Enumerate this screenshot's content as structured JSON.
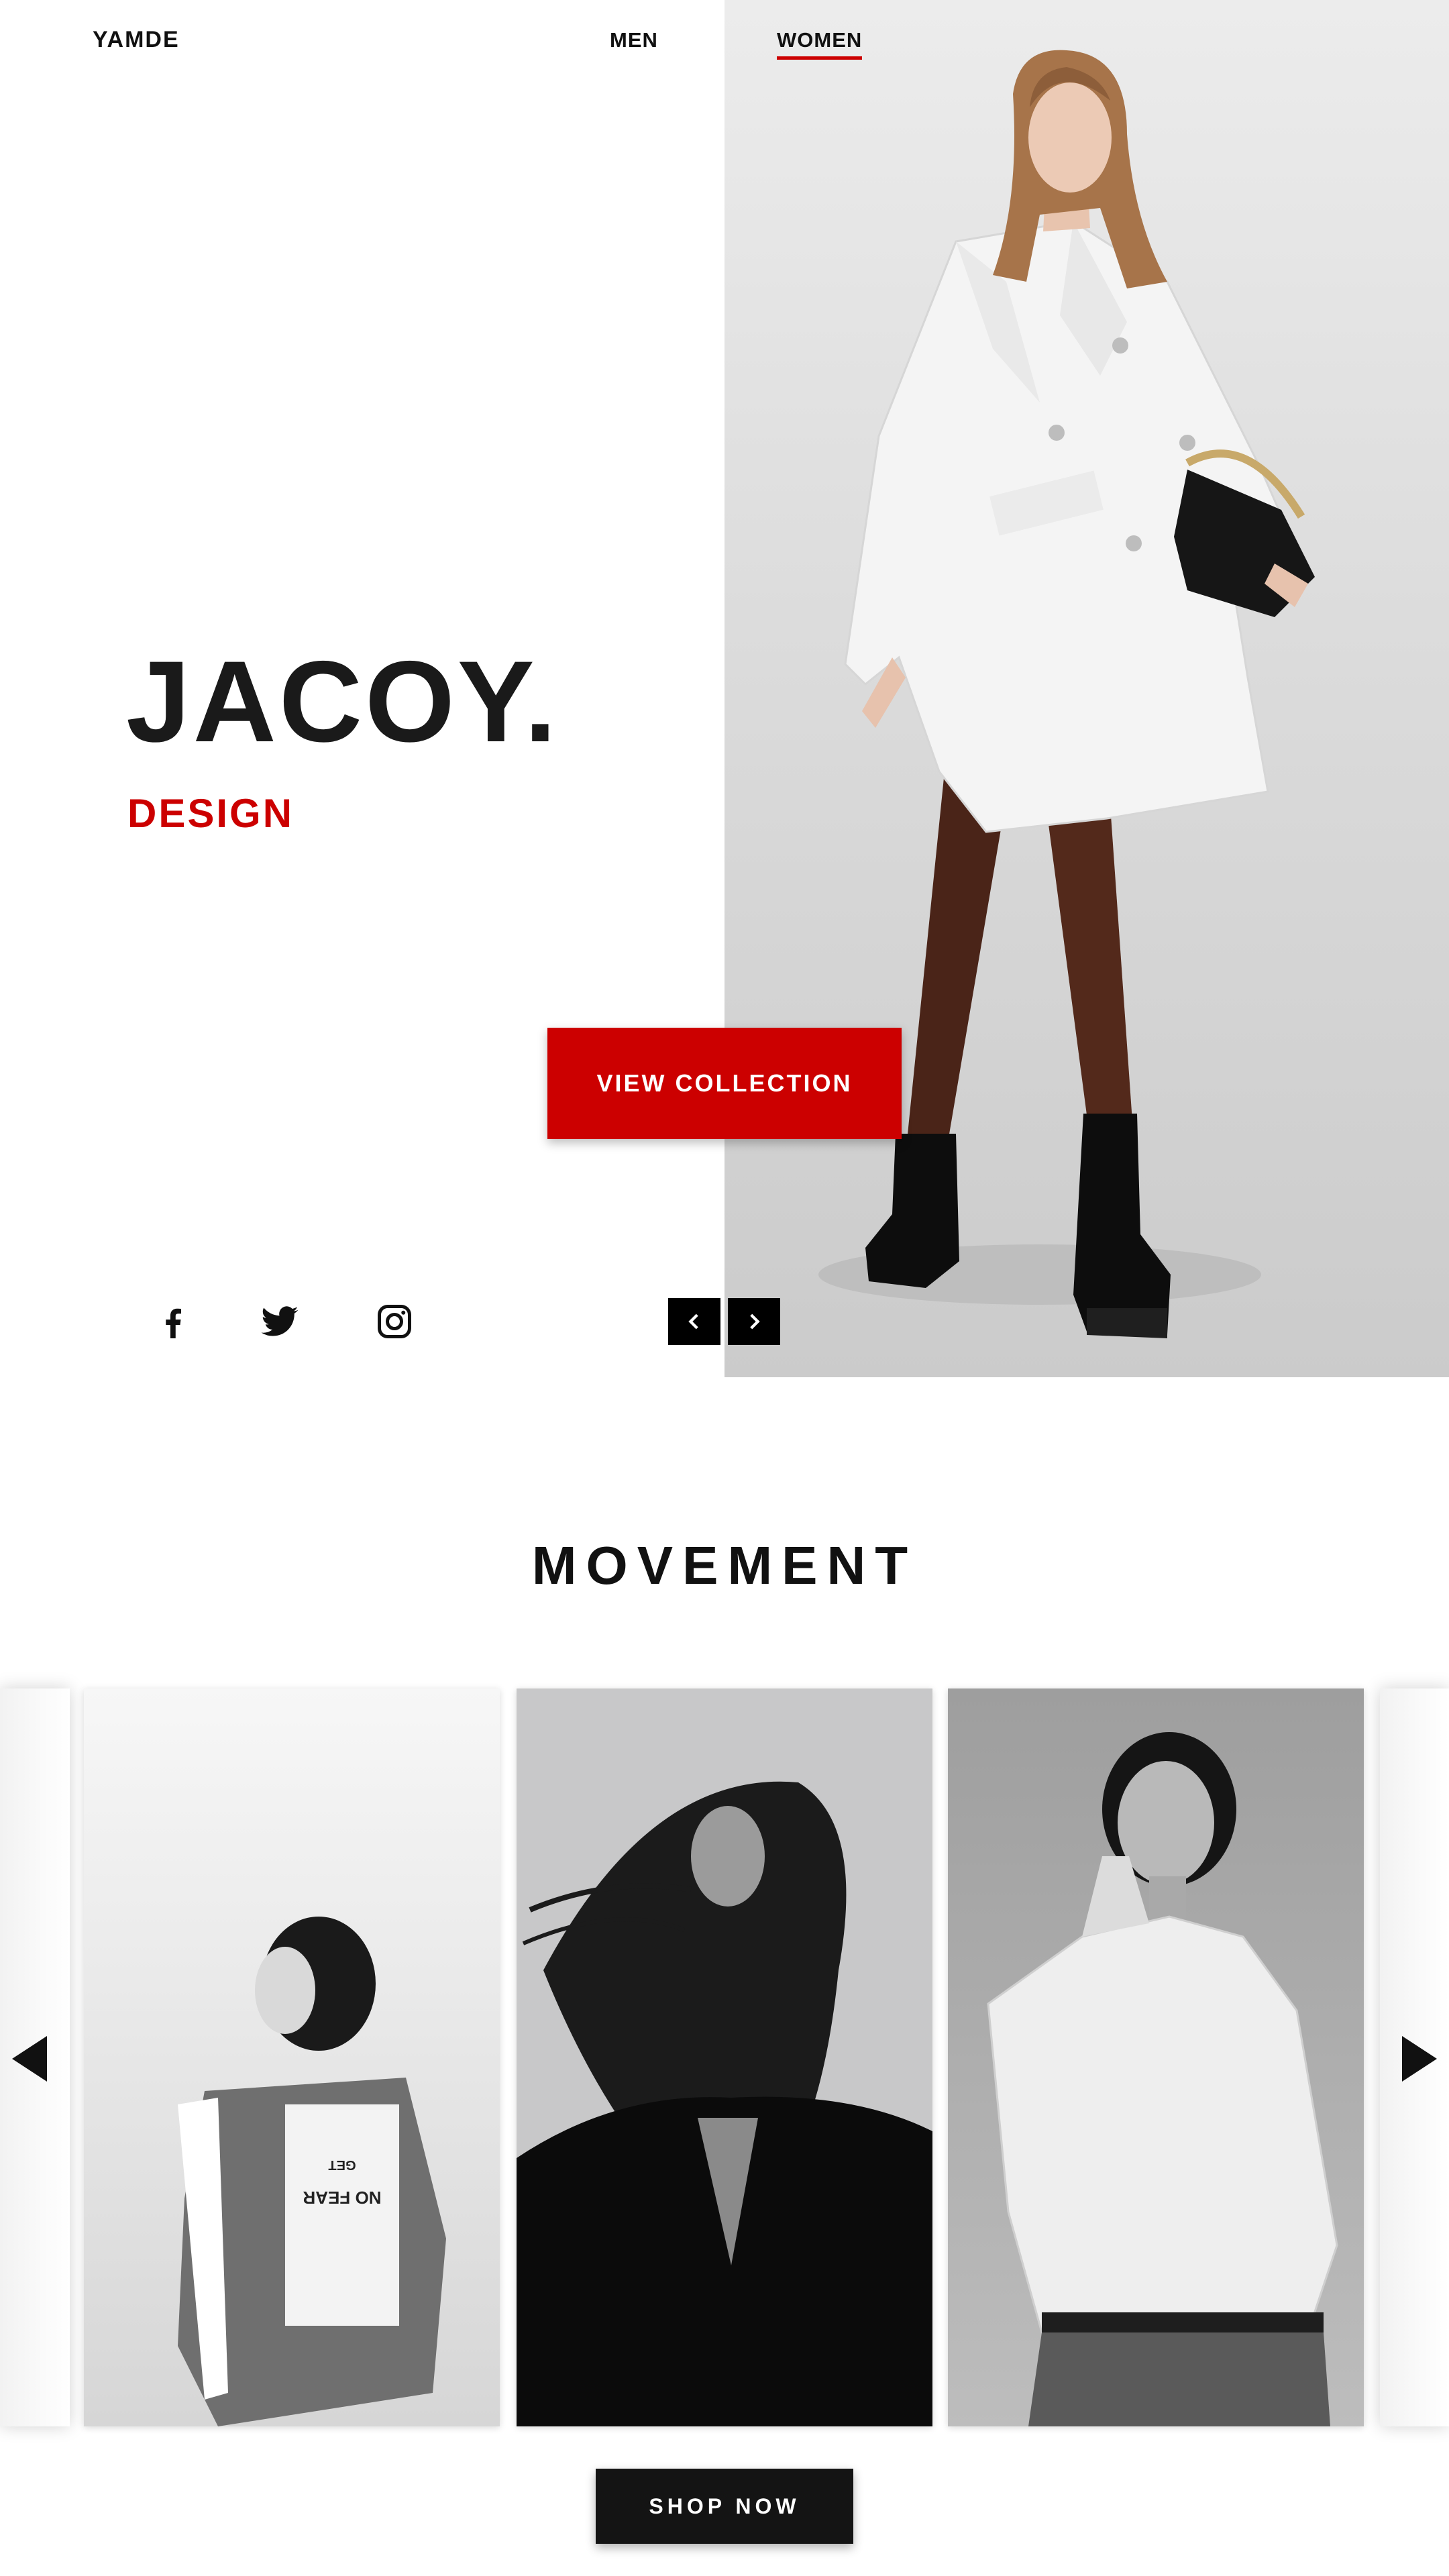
{
  "brand": {
    "logo": "YAMDE"
  },
  "nav": {
    "items": [
      {
        "label": "MEN",
        "active": false
      },
      {
        "label": "WOMEN",
        "active": true
      }
    ]
  },
  "hero": {
    "title": "JACOY.",
    "subtitle": "DESIGN",
    "cta_label": "VIEW COLLECTION",
    "slider_prev_icon": "chevron-left-icon",
    "slider_next_icon": "chevron-right-icon"
  },
  "social": [
    {
      "name": "facebook",
      "icon": "facebook-icon"
    },
    {
      "name": "twitter",
      "icon": "twitter-icon"
    },
    {
      "name": "instagram",
      "icon": "instagram-icon"
    }
  ],
  "movement": {
    "title": "MOVEMENT",
    "cards": [
      {
        "jacket_print_lines": [
          "NO FEAR",
          "GET"
        ]
      },
      {},
      {}
    ],
    "prev_icon": "triangle-left-icon",
    "next_icon": "triangle-right-icon",
    "cta_label": "SHOP NOW"
  },
  "colors": {
    "accent": "#cc0000",
    "dark": "#111111",
    "background": "#ffffff"
  }
}
